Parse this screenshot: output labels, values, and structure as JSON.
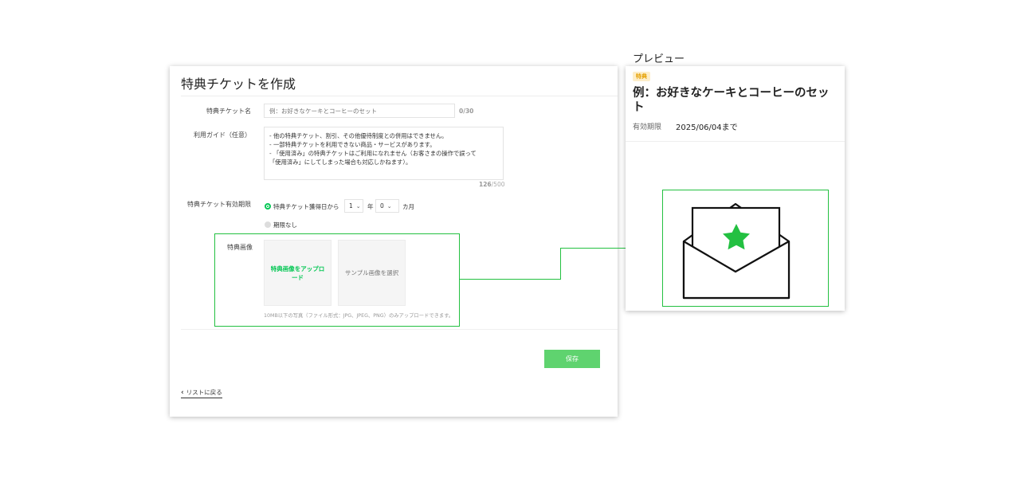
{
  "form": {
    "title": "特典チケットを作成",
    "name_label": "特典チケット名",
    "name_placeholder": "例：お好きなケーキとコーヒーのセット",
    "name_counter": "0/30",
    "guide_label": "利用ガイド（任意）",
    "guide_lines": [
      "- 他の特典チケット、割引、その他優待制度との併用はできません。",
      "- 一部特典チケットを利用できない商品・サービスがあります。",
      "- 「使用済み」の特典チケットはご利用になれません（お客さまの操作で誤って",
      "「使用済み」にしてしまった場合も対応しかねます）。"
    ],
    "guide_counter_used": "126",
    "guide_counter_max": "/500",
    "validity_label": "特典チケット有効期限",
    "validity_option_from": "特典チケット獲得日から",
    "validity_years": "1",
    "validity_year_unit": "年",
    "validity_months": "0",
    "validity_month_unit": "カ月",
    "validity_option_none": "期限なし",
    "image_label": "特典画像",
    "upload_label": "特典画像をアップロード",
    "sample_label": "サンプル画像を選択",
    "image_hint": "10MB以下の写真（ファイル形式：JPG、JPEG、PNG）のみアップロードできます。",
    "save_label": "保存",
    "back_label": "リストに戻る"
  },
  "preview": {
    "heading": "プレビュー",
    "badge": "特典",
    "title": "例：お好きなケーキとコーヒーのセット",
    "validity_label": "有効期限",
    "validity_value": "2025/06/04まで"
  },
  "colors": {
    "accent_green": "#06c755",
    "highlight_green": "#23c041",
    "save_button": "#5fd36f",
    "badge_bg": "#fdeec9",
    "badge_text": "#e5a000"
  },
  "icons": {
    "envelope": "envelope-star-icon",
    "back": "chevron-left-icon",
    "select_arrow": "chevron-down-icon"
  }
}
